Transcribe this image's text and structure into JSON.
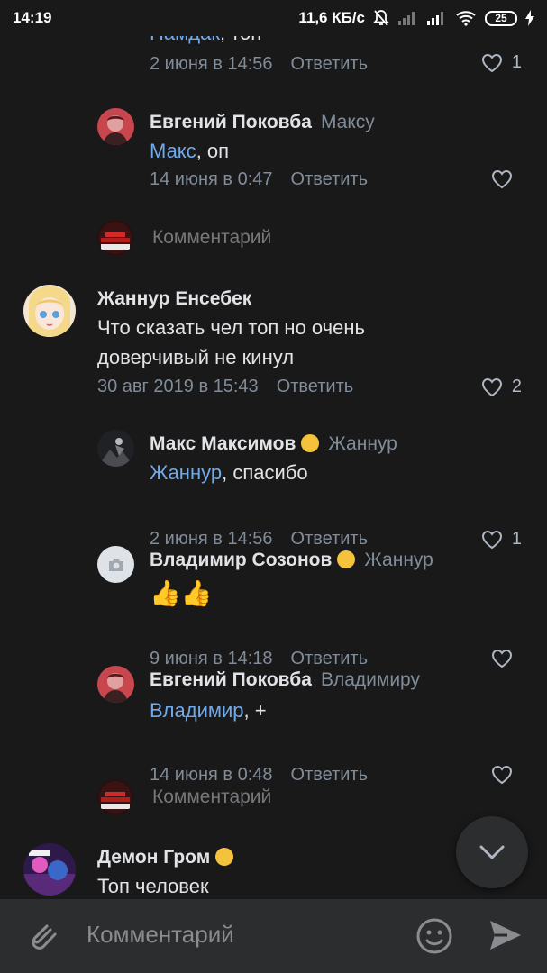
{
  "status_bar": {
    "time": "14:19",
    "speed": "11,6 КБ/с",
    "battery": "25"
  },
  "comments": [
    {
      "author": "",
      "reply_to": "",
      "mention": "Намдак",
      "text": ", топ",
      "date": "2 июня в 14:56",
      "reply_label": "Ответить",
      "likes": "1"
    },
    {
      "author": "Евгений Поковба",
      "reply_to": "Максу",
      "mention": "Макс",
      "text": ", оп",
      "date": "14 июня в 0:47",
      "reply_label": "Ответить",
      "likes": ""
    },
    {
      "author": "Жаннур Енсебек",
      "reply_to": "",
      "mention": "",
      "text": "Что сказать чел топ но очень доверчивый не кинул",
      "date": "30 авг 2019 в 15:43",
      "reply_label": "Ответить",
      "likes": "2"
    },
    {
      "author": "Макс Максимов",
      "reply_to": "Жаннур",
      "mention": "Жаннур",
      "text": ", спасибо",
      "date": "2 июня в 14:56",
      "reply_label": "Ответить",
      "likes": "1"
    },
    {
      "author": "Владимир Созонов",
      "reply_to": "Жаннур",
      "mention": "",
      "text": "👍👍",
      "date": "9 июня в 14:18",
      "reply_label": "Ответить",
      "likes": ""
    },
    {
      "author": "Евгений Поковба",
      "reply_to": "Владимиру",
      "mention": "Владимир",
      "text": ", +",
      "date": "14 июня в 0:48",
      "reply_label": "Ответить",
      "likes": ""
    },
    {
      "author": "Демон Гром",
      "reply_to": "",
      "mention": "",
      "text": "Топ человек",
      "date": "",
      "reply_label": "",
      "likes": ""
    }
  ],
  "comment_prompt": {
    "label": "Комментарий"
  },
  "composer": {
    "placeholder": "Комментарий"
  },
  "colors": {
    "accent": "#71aaeb",
    "background": "#19191a",
    "panel": "#2c2d2e",
    "muted": "#818c99"
  }
}
